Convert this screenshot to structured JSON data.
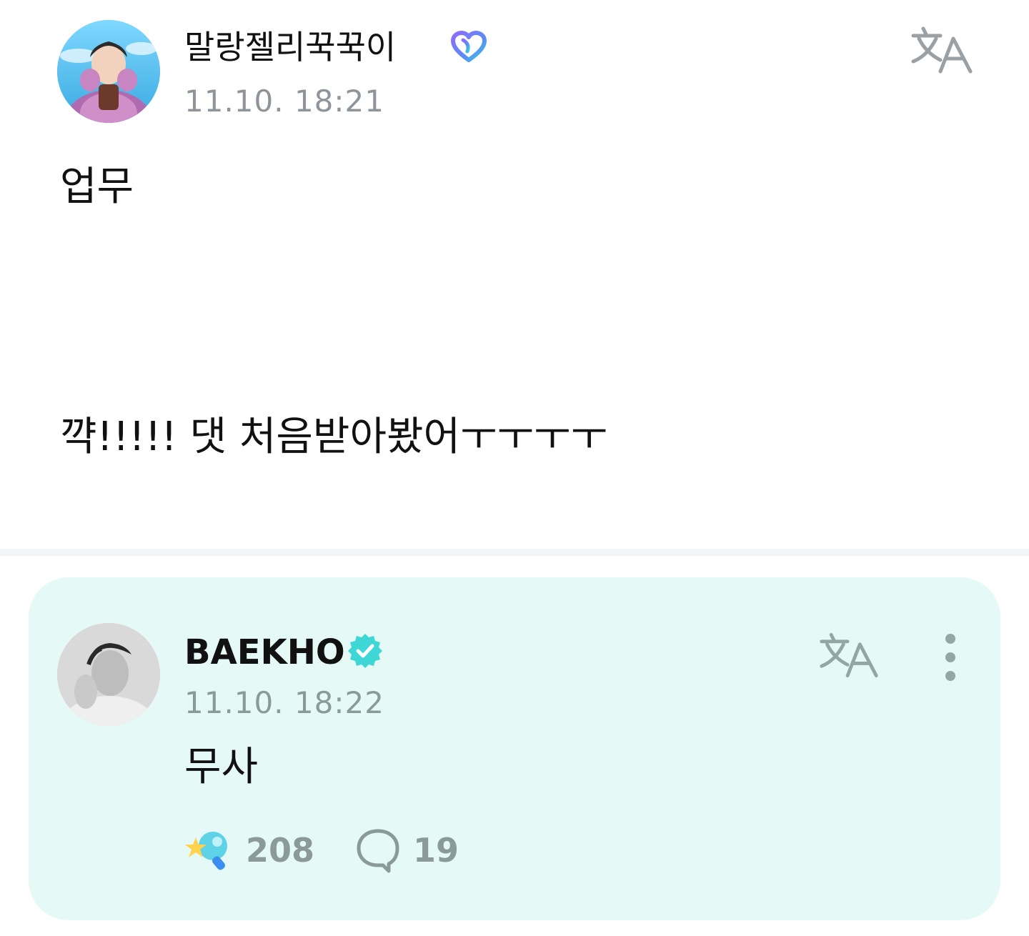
{
  "post": {
    "username": "말랑젤리꾹꾹이",
    "timestamp": "11.10. 18:21",
    "body_line1": "업무",
    "body_line2": "꺅!!!!! 댓 처음받아봤어ㅜㅜㅜㅜ",
    "badge_icon": "heart-badge-icon",
    "translate_icon": "translate-icon"
  },
  "reply": {
    "username": "BAEKHO",
    "timestamp": "11.10. 18:22",
    "body": "무사",
    "verified_icon": "verified-badge-icon",
    "translate_icon": "translate-icon",
    "more_icon": "more-vertical-icon",
    "reaction_count": "208",
    "comment_count": "19"
  },
  "colors": {
    "card_background": "#e5faf6",
    "verified_badge": "#3fd6d6",
    "muted_text": "#8e9499"
  }
}
